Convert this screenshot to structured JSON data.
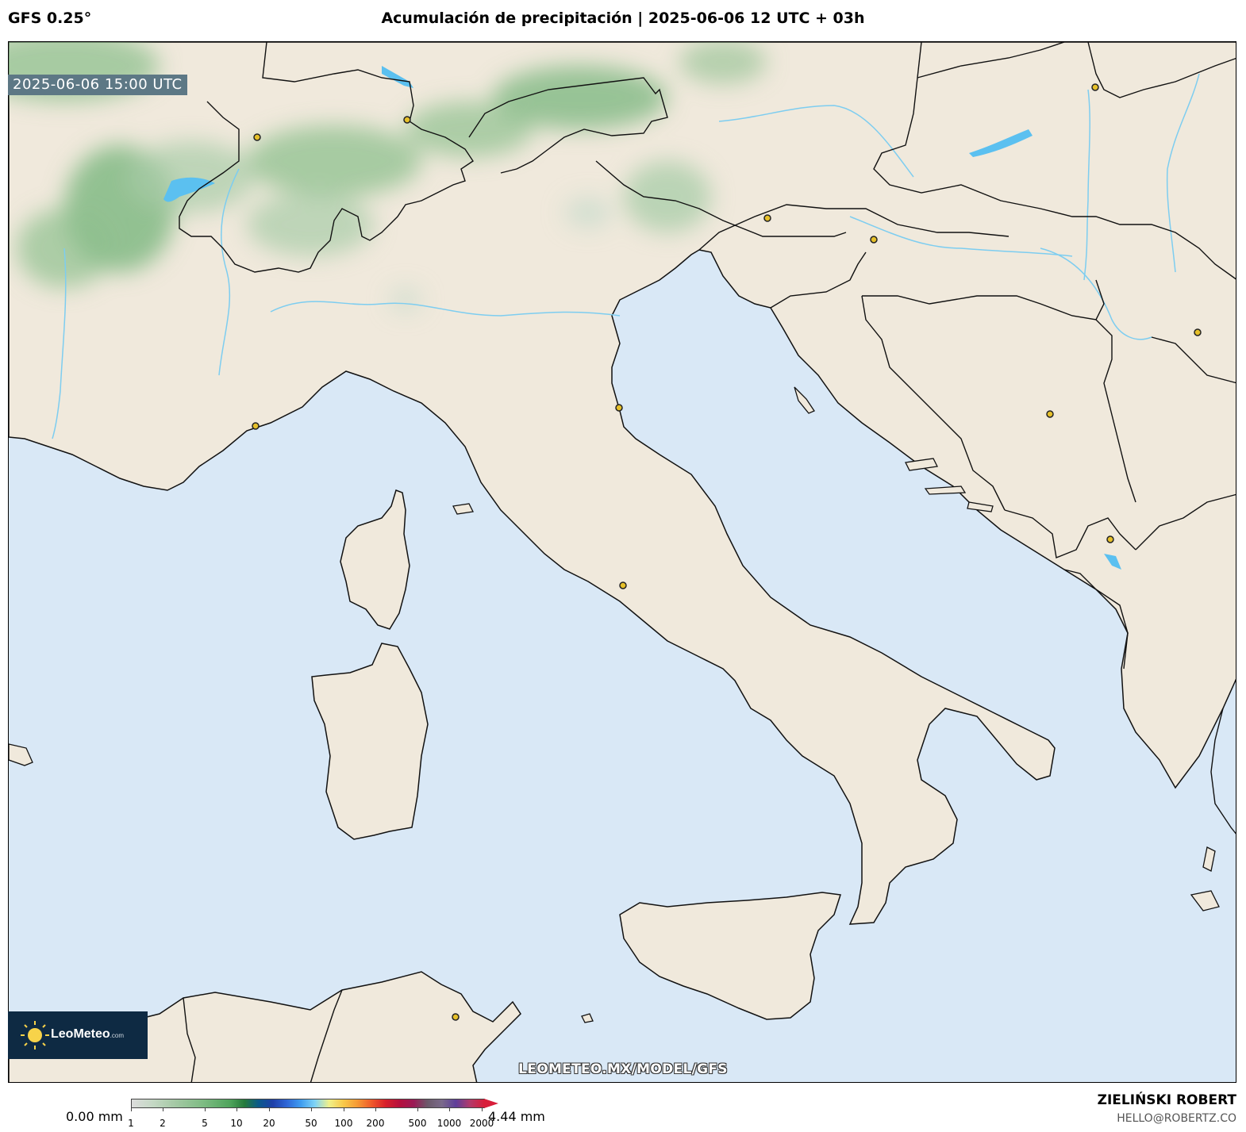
{
  "header": {
    "model": "GFS 0.25°",
    "title": "Acumulación de precipitación | 2025-06-06 12 UTC + 03h"
  },
  "map": {
    "valid_time": "2025-06-06 15:00 UTC",
    "watermark": "LEOMETEO.MX/MODEL/GFS",
    "colors": {
      "sea": "#d9e8f6",
      "land": "#f0e9dc",
      "border": "#111111",
      "river": "#7dcdf0",
      "lake": "#5bc0f0",
      "precip_light": "#b8d4b8",
      "precip_medium": "#8fc08f",
      "city_marker": "#e6c02a"
    }
  },
  "logo": {
    "brand": "LeoMeteo",
    "suffix": ".com",
    "icon": "sun-icon"
  },
  "legend": {
    "min_label": "0.00 mm",
    "max_label": "4.44 mm",
    "ticks": [
      "1",
      "2",
      "5",
      "10",
      "20",
      "50",
      "100",
      "200",
      "500",
      "1000",
      "2000"
    ]
  },
  "credits": {
    "author": "ZIELIŃSKI ROBERT",
    "email": "HELLO@ROBERTZ.CO"
  }
}
